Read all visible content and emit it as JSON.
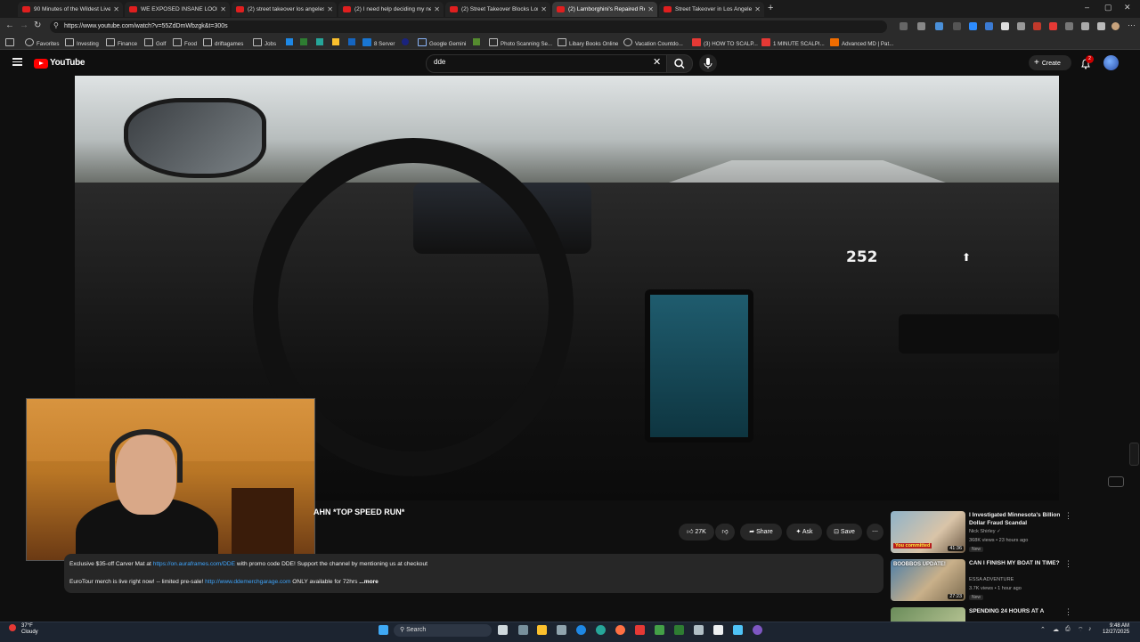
{
  "browser": {
    "tabs": [
      {
        "title": "90 Minutes of the Wildest Live Tra",
        "active": false
      },
      {
        "title": "WE EXPOSED INSANE LOOPHOLE",
        "active": false
      },
      {
        "title": "(2) street takeover los angeles - Yo",
        "active": false
      },
      {
        "title": "(2) I need help deciding my next v",
        "active": false
      },
      {
        "title": "(2) Street Takeover Blocks Long Be",
        "active": false
      },
      {
        "title": "(2) Lamborghini's Repaired Revue",
        "active": true
      },
      {
        "title": "Street Takeover in Los Angeles - Y",
        "active": false
      }
    ],
    "new_tab": "+",
    "url": "https://www.youtube.com/watch?v=55ZdDmWbzgk&t=300s",
    "window_controls": {
      "minimize": "–",
      "maximize": "▢",
      "close": "✕"
    },
    "nav": {
      "back": "←",
      "forward": "→",
      "reload": "↻",
      "home": "⌂"
    },
    "bookmarks": [
      "Favorites",
      "Investing",
      "Finance",
      "Golf",
      "Food",
      "driftagames",
      "Jobs",
      "8 Server",
      "Google Gemini",
      "Photo Scanning Se...",
      "Libary Books Online",
      "Vacation Countdo...",
      "(3) HOW TO SCALP...",
      "1 MINUTE SCALPI...",
      "Advanced MD | Pat..."
    ]
  },
  "youtube": {
    "logo": "YouTube",
    "search_value": "dde",
    "create_label": "Create",
    "notification_count": "2",
    "brand_color": "#ff0000"
  },
  "video": {
    "hud_speed": "252",
    "title": "AHN *TOP SPEED RUN*",
    "likes": "27K",
    "share": "Share",
    "ask": "Ask",
    "save": "Save"
  },
  "description": {
    "line1_pre": "Exclusive $35-off Carver Mat at ",
    "line1_link": "https://on.auraframes.com/DDE",
    "line1_post": " with promo code DDE! Support the channel by mentioning us at checkout",
    "line2_pre": "EuroTour merch is live right now! -- limited pre-sale! ",
    "line2_link": "http://www.ddemerchgarage.com",
    "line2_post": " ONLY available for 72hrs",
    "more": "...more"
  },
  "recommendations": [
    {
      "title": "I Investigated Minnesota's Billion Dollar Fraud Scandal",
      "channel": "Nick Shirley ✓",
      "meta": "368K views • 23 hours ago",
      "badge": "New",
      "duration": "41:36",
      "overlay": "You committed"
    },
    {
      "title": "CAN I FINISH MY BOAT IN TIME?",
      "channel": "ESSA ADVENTURE",
      "meta": "3.7K views • 1 hour ago",
      "badge": "New",
      "duration": "27:23",
      "overlay": "BOOBBOS UPDATE!"
    },
    {
      "title": "SPENDING 24 HOURS AT A",
      "channel": "",
      "meta": "",
      "badge": "",
      "duration": "",
      "overlay": ""
    }
  ],
  "taskbar": {
    "weather_temp": "37°F",
    "weather_desc": "Cloudy",
    "search": "Search",
    "time": "9:48 AM",
    "date": "12/27/2025"
  }
}
